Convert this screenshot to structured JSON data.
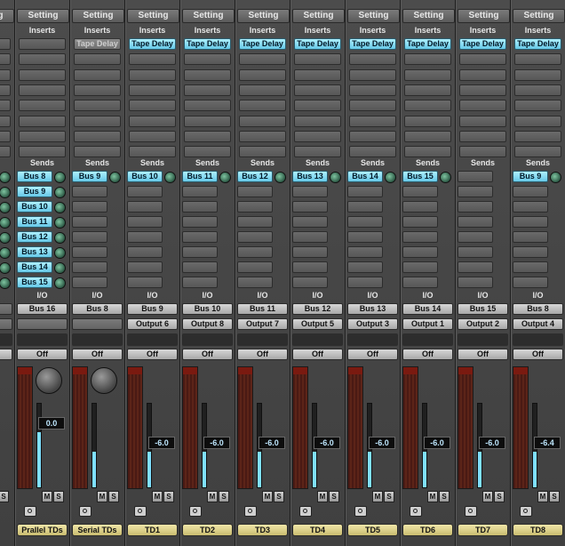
{
  "labels": {
    "setting": "Setting",
    "inserts": "Inserts",
    "sends": "Sends",
    "io": "I/O",
    "off": "Off",
    "mute": "M",
    "solo": "S"
  },
  "colors": {
    "plugin_slot": "#8ee0f5",
    "send_active": "#8ee0f5",
    "track_name": "#e8dd94",
    "fader_level": "#7fe0ff"
  },
  "strips": [
    {
      "name": "",
      "insert": "",
      "insert_dim": false,
      "sends": [
        "Bus 8",
        "Bus 9",
        "Bus 10",
        "Bus 11",
        "Bus 12",
        "Bus 13",
        "Bus 14",
        "Bus 15"
      ],
      "input": "",
      "output": "",
      "fader_value": "",
      "pan_knob": false,
      "partial": true
    },
    {
      "name": "Prallel TDs",
      "insert": "",
      "insert_dim": false,
      "sends": [
        "Bus 8",
        "Bus 9",
        "Bus 10",
        "Bus 11",
        "Bus 12",
        "Bus 13",
        "Bus 14",
        "Bus 15"
      ],
      "input": "Bus 16",
      "output": "",
      "fader_value": "0.0",
      "pan_knob": true
    },
    {
      "name": "Serial TDs",
      "insert": "Tape Delay",
      "insert_dim": true,
      "sends": [
        "Bus 9"
      ],
      "input": "Bus 8",
      "output": "",
      "fader_value": "",
      "pan_knob": true
    },
    {
      "name": "TD1",
      "insert": "Tape Delay",
      "insert_dim": false,
      "sends": [
        "Bus 10"
      ],
      "input": "Bus 9",
      "output": "Output 6",
      "fader_value": "-6.0",
      "pan_knob": false
    },
    {
      "name": "TD2",
      "insert": "Tape Delay",
      "insert_dim": false,
      "sends": [
        "Bus 11"
      ],
      "input": "Bus 10",
      "output": "Output 8",
      "fader_value": "-6.0",
      "pan_knob": false
    },
    {
      "name": "TD3",
      "insert": "Tape Delay",
      "insert_dim": false,
      "sends": [
        "Bus 12"
      ],
      "input": "Bus 11",
      "output": "Output 7",
      "fader_value": "-6.0",
      "pan_knob": false
    },
    {
      "name": "TD4",
      "insert": "Tape Delay",
      "insert_dim": false,
      "sends": [
        "Bus 13"
      ],
      "input": "Bus 12",
      "output": "Output 5",
      "fader_value": "-6.0",
      "pan_knob": false
    },
    {
      "name": "TD5",
      "insert": "Tape Delay",
      "insert_dim": false,
      "sends": [
        "Bus 14"
      ],
      "input": "Bus 13",
      "output": "Output 3",
      "fader_value": "-6.0",
      "pan_knob": false
    },
    {
      "name": "TD6",
      "insert": "Tape Delay",
      "insert_dim": false,
      "sends": [
        "Bus 15"
      ],
      "input": "Bus 14",
      "output": "Output 1",
      "fader_value": "-6.0",
      "pan_knob": false
    },
    {
      "name": "TD7",
      "insert": "Tape Delay",
      "insert_dim": false,
      "sends": [],
      "input": "Bus 15",
      "output": "Output 2",
      "fader_value": "-6.0",
      "pan_knob": false
    },
    {
      "name": "TD8",
      "insert": "Tape Delay",
      "insert_dim": false,
      "sends": [
        "Bus 9"
      ],
      "input": "Bus 8",
      "output": "Output 4",
      "fader_value": "-6.4",
      "pan_knob": false
    }
  ]
}
